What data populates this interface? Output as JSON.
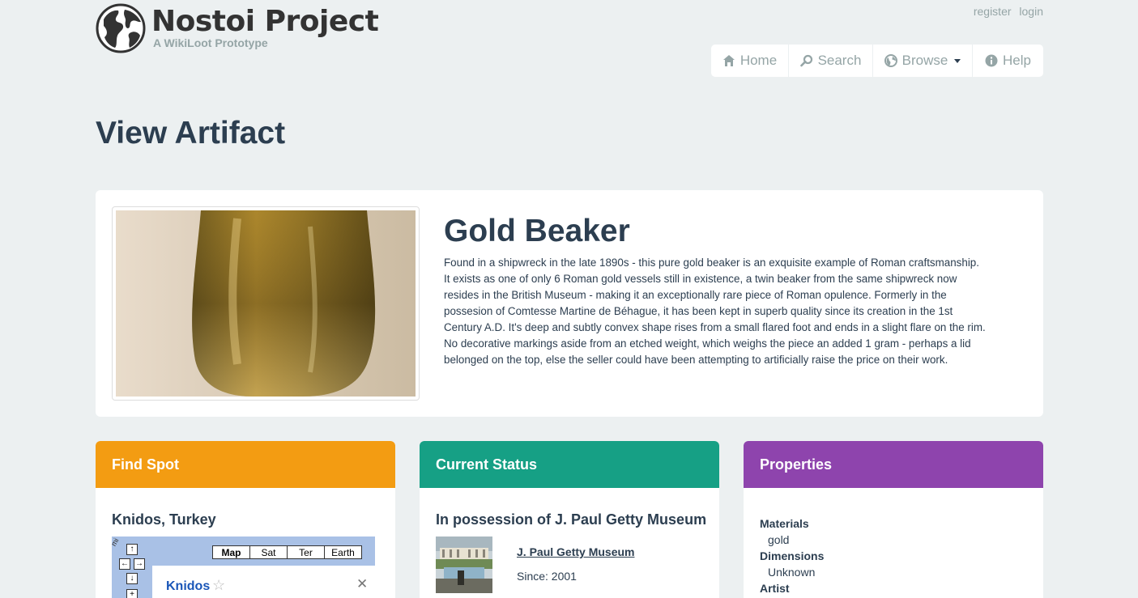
{
  "brand": {
    "title": "Nostoi Project",
    "subtitle": "A WikiLoot Prototype",
    "logo_icon": "globe-icon"
  },
  "auth": {
    "register": "register",
    "login": "login"
  },
  "nav": {
    "home": {
      "label": "Home",
      "icon": "home-icon"
    },
    "search": {
      "label": "Search",
      "icon": "search-icon"
    },
    "browse": {
      "label": "Browse",
      "icon": "globe-icon"
    },
    "help": {
      "label": "Help",
      "icon": "info-icon"
    }
  },
  "page_title": "View Artifact",
  "artifact": {
    "title": "Gold Beaker",
    "description": "Found in a shipwreck in the late 1890s - this pure gold beaker is an exquisite example of Roman craftsmanship. It exists as one of only 6 Roman gold vessels still in existence, a twin beaker from the same shipwreck now resides in the British Museum - making it an exceptionally rare piece of Roman opulence. Formerly in the possesion of Comtesse Martine de Béhague, it has been kept in superb quality since its creation in the 1st Century A.D. It's deep and subtly convex shape rises from a small flared foot and ends in a slight flare on the rim. No decorative markings aside from an etched weight, which weighs the piece an added 1 gram - perhaps a lid belonged on the top, else the seller could have been attempting to artificially raise the price on their work."
  },
  "find_spot": {
    "header": "Find Spot",
    "location": "Knidos, Turkey",
    "map": {
      "types": [
        "Map",
        "Sat",
        "Ter",
        "Earth"
      ],
      "active_type": "Map",
      "place": "Knidos",
      "scale_fragment": "mi"
    }
  },
  "current_status": {
    "header": "Current Status",
    "possession": "In possession of J. Paul Getty Museum",
    "museum_link": "J. Paul Getty Museum",
    "since": "Since: 2001"
  },
  "properties": {
    "header": "Properties",
    "materials_label": "Materials",
    "materials_value": "gold",
    "dimensions_label": "Dimensions",
    "dimensions_value": "Unknown",
    "artist_label": "Artist"
  },
  "colors": {
    "background": "#ecf0f1",
    "text": "#2c3e50",
    "find_spot": "#f39c12",
    "current_status": "#16a085",
    "properties": "#8e44ad",
    "muted": "#95a5a6"
  }
}
